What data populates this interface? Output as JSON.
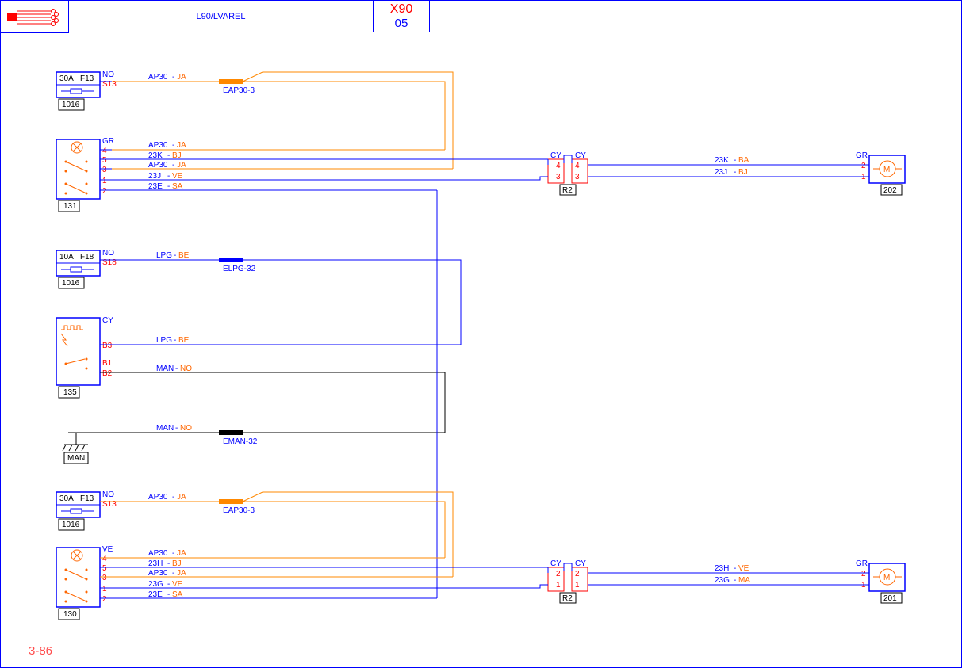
{
  "header": {
    "title": "L90/LVAREL",
    "code_top": "X90",
    "code_bot": "05"
  },
  "page_num": "3-86",
  "components": {
    "fuse1": {
      "rating": "30A",
      "name": "F13",
      "box": "1016",
      "conn": "NO",
      "pin": "S13"
    },
    "fuse2": {
      "rating": "10A",
      "name": "F18",
      "box": "1016",
      "conn": "NO",
      "pin": "S18"
    },
    "fuse3": {
      "rating": "30A",
      "name": "F13",
      "box": "1016",
      "conn": "NO",
      "pin": "S13"
    },
    "comp131": {
      "id": "131",
      "conn": "GR",
      "pins": [
        "4",
        "5",
        "3",
        "1",
        "2"
      ]
    },
    "comp135": {
      "id": "135",
      "conn": "CY",
      "pins": [
        "B3",
        "B1",
        "B2"
      ]
    },
    "comp130": {
      "id": "130",
      "conn": "VE",
      "pins": [
        "4",
        "5",
        "3",
        "1",
        "2"
      ]
    },
    "r2a": {
      "id": "R2",
      "conn_l": "CY",
      "conn_r": "CY",
      "pins_l": [
        "4",
        "3"
      ],
      "pins_r": [
        "4",
        "3"
      ]
    },
    "r2b": {
      "id": "R2",
      "conn_l": "CY",
      "conn_r": "CY",
      "pins_l": [
        "2",
        "1"
      ],
      "pins_r": [
        "2",
        "1"
      ]
    },
    "comp202": {
      "id": "202",
      "conn": "GR",
      "pins": [
        "2",
        "1"
      ]
    },
    "comp201": {
      "id": "201",
      "conn": "GR",
      "pins": [
        "2",
        "1"
      ]
    },
    "ground": {
      "id": "MAN"
    }
  },
  "wires": {
    "w1": {
      "code": "AP30",
      "color": "JA"
    },
    "w2": {
      "code": "AP30",
      "color": "JA"
    },
    "w3": {
      "code": "23K",
      "color": "BJ"
    },
    "w4": {
      "code": "AP30",
      "color": "JA"
    },
    "w5": {
      "code": "23J",
      "color": "VE"
    },
    "w6": {
      "code": "23E",
      "color": "SA"
    },
    "w7": {
      "code": "23K",
      "color": "BA"
    },
    "w8": {
      "code": "23J",
      "color": "BJ"
    },
    "w9": {
      "code": "LPG",
      "color": "BE"
    },
    "w10": {
      "code": "LPG",
      "color": "BE"
    },
    "w11": {
      "code": "MAN",
      "color": "NO"
    },
    "w12": {
      "code": "MAN",
      "color": "NO"
    },
    "w13": {
      "code": "AP30",
      "color": "JA"
    },
    "w14": {
      "code": "AP30",
      "color": "JA"
    },
    "w15": {
      "code": "23H",
      "color": "BJ"
    },
    "w16": {
      "code": "AP30",
      "color": "JA"
    },
    "w17": {
      "code": "23G",
      "color": "VE"
    },
    "w18": {
      "code": "23E",
      "color": "SA"
    },
    "w19": {
      "code": "23H",
      "color": "VE"
    },
    "w20": {
      "code": "23G",
      "color": "MA"
    }
  },
  "splices": {
    "s1": "EAP30-3",
    "s2": "ELPG-32",
    "s3": "EMAN-32",
    "s4": "EAP30-3"
  }
}
